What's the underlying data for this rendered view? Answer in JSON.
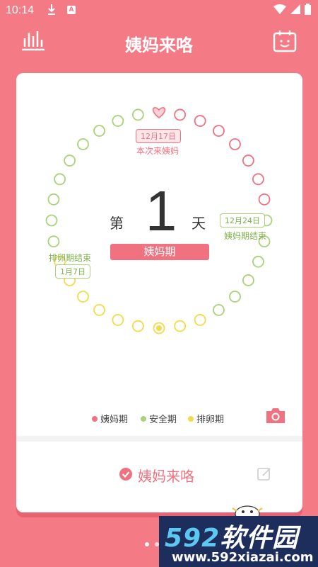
{
  "status_bar": {
    "time": "10:14",
    "badge": "A"
  },
  "header": {
    "title": "姨妈来咯"
  },
  "main": {
    "day_prefix": "第",
    "day_number": "1",
    "day_suffix": "天",
    "phase_label": "姨妈期",
    "bubbles": {
      "next_period_date": "12月17日",
      "next_period_label": "本次来姨妈",
      "period_end_date": "12月24日",
      "period_end_label": "姨妈期结束",
      "ovulation_end_date": "1月7日",
      "ovulation_end_label": "排卵期结束"
    },
    "legend": [
      {
        "label": "姨妈期",
        "color": "#F07280"
      },
      {
        "label": "安全期",
        "color": "#A9D27A"
      },
      {
        "label": "排卵期",
        "color": "#F2DB4A"
      }
    ],
    "action_label": "姨妈来咯"
  },
  "colors": {
    "brand": "#F47B86",
    "period": "#F07280",
    "safe": "#A9D27A",
    "ovulation": "#F2DB4A"
  },
  "watermark": {
    "brand_num": "592",
    "brand_text": "软件园",
    "url": "www.592xiazai.com"
  }
}
